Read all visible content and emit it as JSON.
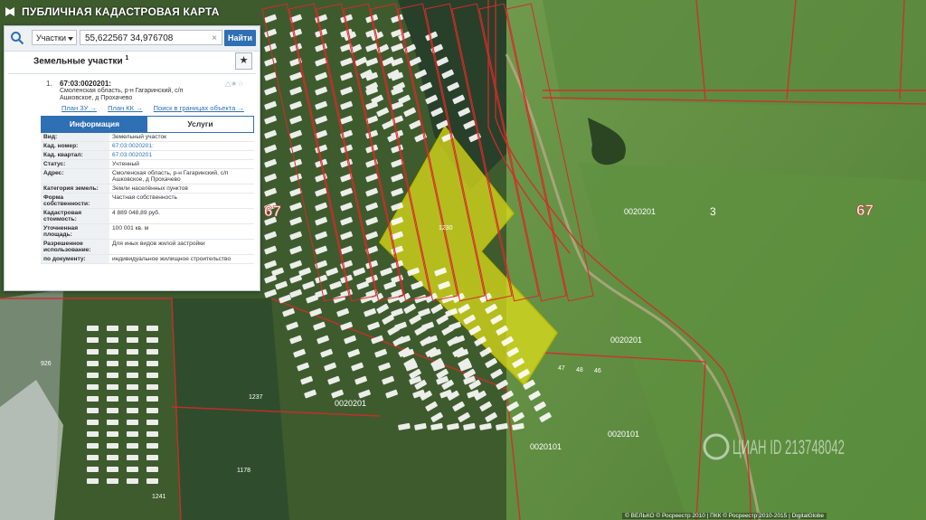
{
  "app": {
    "title": "ПУБЛИЧНАЯ КАДАСТРОВАЯ КАРТА"
  },
  "search": {
    "type_label": "Участки",
    "query": "55,622567 34,976708",
    "find_label": "Найти"
  },
  "results": {
    "section_title": "Земельные участки",
    "count": "1"
  },
  "item": {
    "num": "1.",
    "cad_number": "67:03:0020201:",
    "address_short": "Смоленская область, р-н Гагаринский, с/п Ашковское, д Прохачево",
    "links": [
      "План ЗУ →",
      "План КК →",
      "Поиск в границах объекта →"
    ]
  },
  "tabs": {
    "info": "Информация",
    "services": "Услуги"
  },
  "attributes": [
    {
      "k": "Вид:",
      "v": "Земельный участок"
    },
    {
      "k": "Кад. номер:",
      "v": "67:03:0020201:",
      "link": true
    },
    {
      "k": "Кад. квартал:",
      "v": "67:03:0020201",
      "link": true
    },
    {
      "k": "Статус:",
      "v": "Учтенный"
    },
    {
      "k": "Адрес:",
      "v": "Смоленская область, р-н Гагаринский, с/п Ашковское, д Прохачево"
    },
    {
      "k": "Категория земель:",
      "v": "Земли населённых пунктов"
    },
    {
      "k": "Форма собственности:",
      "v": "Частная собственность"
    },
    {
      "k": "Кадастровая стоимость:",
      "v": "4 889 048,89 руб."
    },
    {
      "k": "Уточненная площадь:",
      "v": "100 001 кв. м"
    },
    {
      "k": "Разрешенное использование:",
      "v": "Для иных видов жилой застройки"
    },
    {
      "k": "по документу:",
      "v": "индивидуальное жилищное строительство"
    }
  ],
  "map": {
    "region_labels": [
      "67",
      "3",
      "67"
    ],
    "quarter_labels": [
      "0020201",
      "0020201",
      "0020201",
      "0020101",
      "0020101"
    ],
    "parcel_labels": [
      "1230",
      "1237",
      "1196",
      "1150",
      "926",
      "1178",
      "1241",
      "46",
      "47",
      "48"
    ],
    "copyright": "© ВЕЛЬКО © Росреестр 2010 | ПКК © Росреестр 2010-2015 | DigitalGlobe",
    "watermark": "ЦИАН ID 213748042",
    "colors": {
      "highlight": "#e6e61a",
      "boundary": "#d62a2a",
      "accent": "#2f6fb3"
    }
  }
}
